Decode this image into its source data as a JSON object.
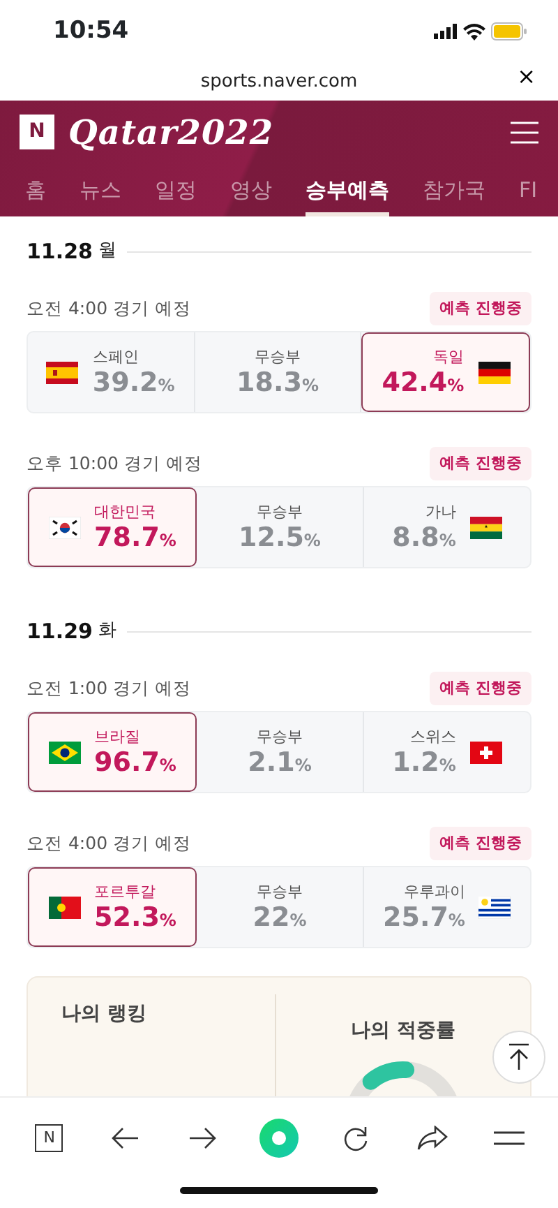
{
  "status_bar": {
    "time": "10:54"
  },
  "url_bar": {
    "url": "sports.naver.com",
    "close": "×"
  },
  "header": {
    "logo_mark": "N",
    "title": "Qatar2022"
  },
  "tabs": [
    {
      "label": "홈",
      "selected": false
    },
    {
      "label": "뉴스",
      "selected": false
    },
    {
      "label": "일정",
      "selected": false
    },
    {
      "label": "영상",
      "selected": false
    },
    {
      "label": "승부예측",
      "selected": true
    },
    {
      "label": "참가국",
      "selected": false
    },
    {
      "label": "FI",
      "selected": false
    }
  ],
  "days": [
    {
      "date": "11.28",
      "weekday": "월",
      "matches": [
        {
          "time": "오전 4:00 경기 예정",
          "badge": "예측 진행중",
          "home": {
            "name": "스페인",
            "pct": "39.2%",
            "kind": "es",
            "selected": false
          },
          "draw": {
            "name": "무승부",
            "pct": "18.3%"
          },
          "away": {
            "name": "독일",
            "pct": "42.4%",
            "kind": "de",
            "selected": true
          }
        },
        {
          "time": "오후 10:00 경기 예정",
          "badge": "예측 진행중",
          "home": {
            "name": "대한민국",
            "pct": "78.7%",
            "kind": "kr",
            "selected": true
          },
          "draw": {
            "name": "무승부",
            "pct": "12.5%"
          },
          "away": {
            "name": "가나",
            "pct": "8.8%",
            "kind": "gh",
            "selected": false
          }
        }
      ]
    },
    {
      "date": "11.29",
      "weekday": "화",
      "matches": [
        {
          "time": "오전 1:00 경기 예정",
          "badge": "예측 진행중",
          "home": {
            "name": "브라질",
            "pct": "96.7%",
            "kind": "br",
            "selected": true
          },
          "draw": {
            "name": "무승부",
            "pct": "2.1%"
          },
          "away": {
            "name": "스위스",
            "pct": "1.2%",
            "kind": "ch",
            "selected": false
          }
        },
        {
          "time": "오전 4:00 경기 예정",
          "badge": "예측 진행중",
          "home": {
            "name": "포르투갈",
            "pct": "52.3%",
            "kind": "pt",
            "selected": true
          },
          "draw": {
            "name": "무승부",
            "pct": "22%"
          },
          "away": {
            "name": "우루과이",
            "pct": "25.7%",
            "kind": "uy",
            "selected": false
          }
        }
      ]
    }
  ],
  "my_stats": {
    "ranking_label": "나의 랭킹",
    "accuracy_label": "나의 적중률"
  },
  "toolbar": {
    "logo_mark": "N"
  }
}
